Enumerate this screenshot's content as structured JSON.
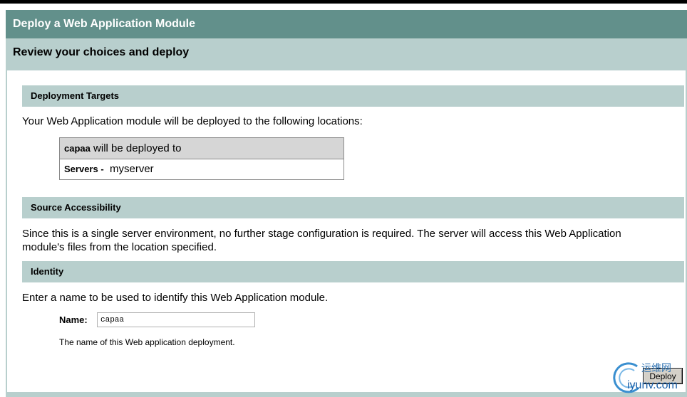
{
  "window": {
    "title": "Deploy a Web Application Module",
    "subtitle": "Review your choices and deploy"
  },
  "targets": {
    "header": "Deployment Targets",
    "intro": "Your Web Application module will be deployed to the following locations:",
    "module_name": "capaa",
    "module_suffix": " will be deployed to",
    "servers_label": "Servers -",
    "servers_value": "myserver"
  },
  "source": {
    "header": "Source Accessibility",
    "text": "Since this is a single server environment, no further stage configuration is required. The server will access this Web Application module's files from the location specified."
  },
  "identity": {
    "header": "Identity",
    "intro": "Enter a name to be used to identify this Web Application module.",
    "name_label": "Name:",
    "name_value": "capaa",
    "hint": "The name of this Web application deployment."
  },
  "actions": {
    "deploy_label": "Deploy"
  },
  "watermark": {
    "line1": "运维网",
    "line2": "iyunv.com"
  },
  "colors": {
    "title_bar": "#62908b",
    "section_bar": "#b8cfcd"
  }
}
